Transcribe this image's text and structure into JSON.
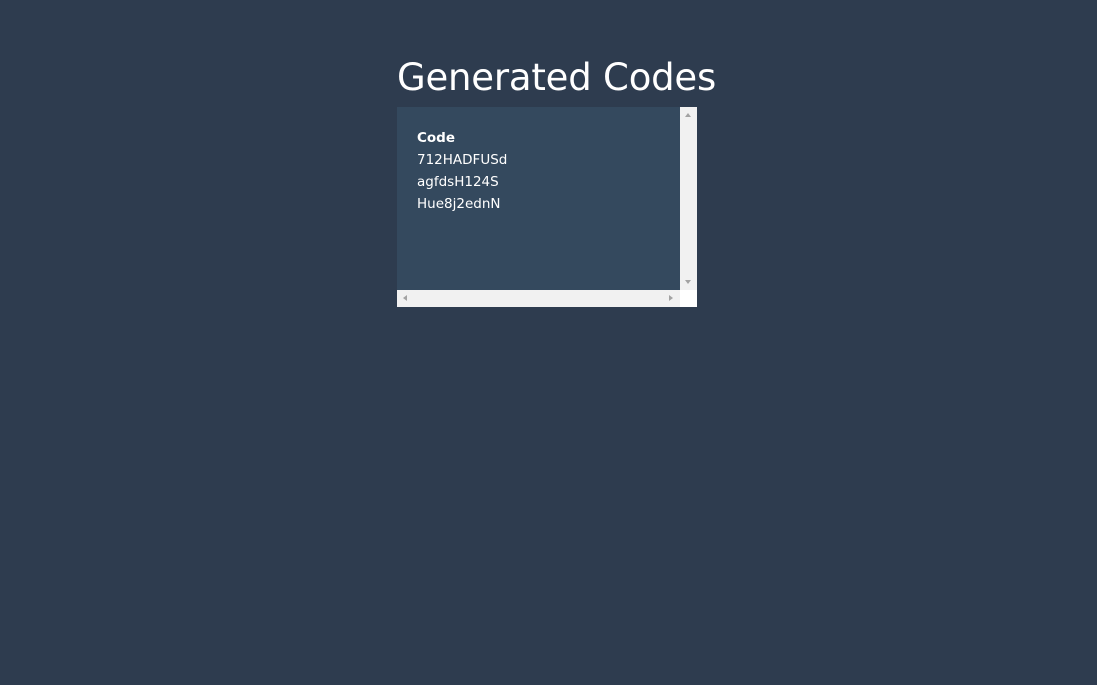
{
  "page": {
    "title": "Generated Codes",
    "background_color": "#2e3c4f",
    "panel_color": "#34495e"
  },
  "codes_table": {
    "header": "Code",
    "rows": [
      "712HADFUSd",
      "agfdsH124S",
      "Hue8j2ednN"
    ]
  },
  "scrollbars": {
    "vertical": {
      "up_icon": "triangle-up-icon",
      "down_icon": "triangle-down-icon"
    },
    "horizontal": {
      "left_icon": "triangle-left-icon",
      "right_icon": "triangle-right-icon"
    }
  }
}
